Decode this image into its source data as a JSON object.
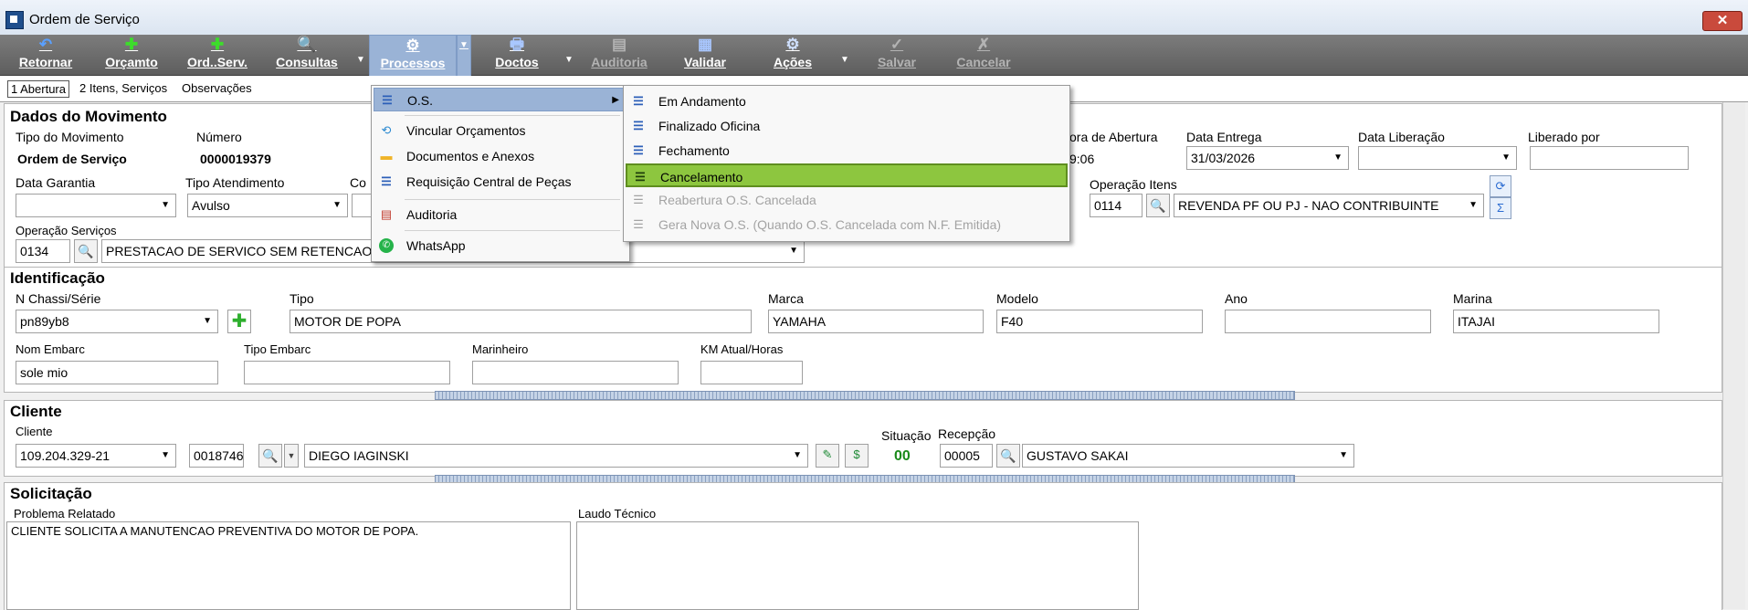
{
  "window": {
    "title": "Ordem de Serviço",
    "close_label": "✕"
  },
  "toolbar": {
    "buttons": [
      {
        "label": "Retornar",
        "icon": "undo-icon",
        "glyph": "↶"
      },
      {
        "label": "Orçamto",
        "icon": "plus-icon",
        "glyph": "✚"
      },
      {
        "label": "Ord..Serv.",
        "icon": "plus-icon",
        "glyph": "✚"
      },
      {
        "label": "Consultas",
        "icon": "search-icon",
        "glyph": "🔍"
      },
      {
        "label": "Processos",
        "icon": "gears-icon",
        "glyph": "⚙"
      },
      {
        "label": "Doctos",
        "icon": "printer-icon",
        "glyph": "🖶"
      },
      {
        "label": "Auditoria",
        "icon": "audit-icon",
        "glyph": "▤"
      },
      {
        "label": "Validar",
        "icon": "validate-icon",
        "glyph": "▦"
      },
      {
        "label": "Ações",
        "icon": "gear-icon",
        "glyph": "⚙"
      },
      {
        "label": "Salvar",
        "icon": "check-icon",
        "glyph": "✓"
      },
      {
        "label": "Cancelar",
        "icon": "cancel-icon",
        "glyph": "✗"
      }
    ]
  },
  "tabs": [
    "1 Abertura",
    "2 Itens, Serviços",
    "Observações"
  ],
  "dados": {
    "title": "Dados do Movimento",
    "tipo_movimento_label": "Tipo do Movimento",
    "tipo_movimento_value": "Ordem de Serviço",
    "numero_label": "Número",
    "numero_value": "0000019379",
    "hora_abertura_label": "ora de Abertura",
    "hora_abertura_value": "9:06",
    "data_entrega_label": "Data Entrega",
    "data_entrega_value": "31/03/2026",
    "data_liberacao_label": "Data Liberação",
    "data_liberacao_value": "",
    "liberado_por_label": "Liberado por",
    "liberado_por_value": "",
    "data_garantia_label": "Data Garantia",
    "data_garantia_value": "",
    "tipo_atendimento_label": "Tipo Atendimento",
    "tipo_atendimento_value": "Avulso",
    "con_label": "Co",
    "operacao_itens_label": "Operação Itens",
    "operacao_itens_code": "0114",
    "operacao_itens_desc": "REVENDA PF OU PJ - NAO CONTRIBUINTE",
    "operacao_servicos_label": "Operação Serviços",
    "operacao_servicos_code": "0134",
    "operacao_servicos_desc": "PRESTACAO DE SERVICO SEM RETENCAO"
  },
  "identificacao": {
    "title": "Identificação",
    "chassi_label": "N Chassi/Série",
    "chassi_value": "pn89yb8",
    "tipo_label": "Tipo",
    "tipo_value": "MOTOR DE POPA",
    "marca_label": "Marca",
    "marca_value": "YAMAHA",
    "modelo_label": "Modelo",
    "modelo_value": "F40",
    "ano_label": "Ano",
    "ano_value": "",
    "marina_label": "Marina",
    "marina_value": "ITAJAI",
    "nom_embarc_label": "Nom Embarc",
    "nom_embarc_value": "sole mio",
    "tipo_embarc_label": "Tipo Embarc",
    "tipo_embarc_value": "",
    "marinheiro_label": "Marinheiro",
    "marinheiro_value": "",
    "km_label": "KM Atual/Horas",
    "km_value": ""
  },
  "cliente": {
    "title": "Cliente",
    "cliente_label": "Cliente",
    "cpf_value": "109.204.329-21",
    "codigo_value": "0018746",
    "nome_value": "DIEGO IAGINSKI",
    "situacao_label": "Situação",
    "situacao_value": "00",
    "recepcao_label": "Recepção",
    "recepcao_code": "00005",
    "recepcao_name": "GUSTAVO SAKAI"
  },
  "solicitacao": {
    "title": "Solicitação",
    "problema_label": "Problema Relatado",
    "problema_value": "CLIENTE SOLICITA A MANUTENCAO PREVENTIVA DO MOTOR DE POPA.",
    "laudo_label": "Laudo Técnico",
    "laudo_value": ""
  },
  "processos_menu": {
    "items": [
      {
        "label": "O.S.",
        "icon": "list-icon",
        "has_submenu": true
      },
      {
        "label": "Vincular Orçamentos",
        "icon": "link-icon"
      },
      {
        "label": "Documentos e Anexos",
        "icon": "folder-icon"
      },
      {
        "label": "Requisição Central de Peças",
        "icon": "list-icon"
      },
      {
        "label": "Auditoria",
        "icon": "audit-icon"
      },
      {
        "label": "WhatsApp",
        "icon": "whatsapp-icon"
      }
    ]
  },
  "os_submenu": {
    "items": [
      {
        "label": "Em Andamento",
        "enabled": true
      },
      {
        "label": "Finalizado Oficina",
        "enabled": true
      },
      {
        "label": "Fechamento",
        "enabled": true
      },
      {
        "label": "Cancelamento",
        "enabled": true,
        "highlighted": true
      },
      {
        "label": "Reabertura O.S. Cancelada",
        "enabled": false
      },
      {
        "label": "Gera Nova O.S. (Quando O.S. Cancelada com N.F. Emitida)",
        "enabled": false
      }
    ]
  },
  "colors": {
    "toolbar_bg": "#6e6e6e",
    "menu_highlight": "#9ab3d6",
    "selected_green": "#8dc63f",
    "situacao_green": "#1a8a1a"
  }
}
